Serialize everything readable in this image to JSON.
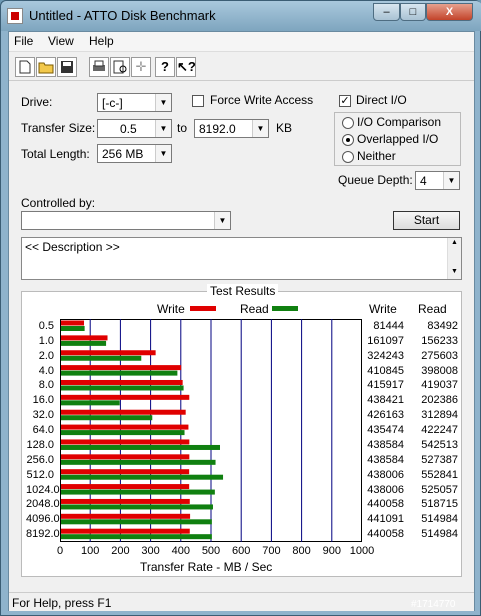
{
  "window": {
    "title": "Untitled - ATTO Disk Benchmark",
    "minimize": "–",
    "maximize": "□",
    "close": "X"
  },
  "menu": [
    "File",
    "View",
    "Help"
  ],
  "toolbar": [
    "⬜",
    "📂",
    "💾",
    "🖨",
    "🔍",
    "✛",
    "?",
    "↖"
  ],
  "form": {
    "drive_label": "Drive:",
    "drive_value": "[-c-]",
    "transfer_label": "Transfer Size:",
    "transfer_from": "0.5",
    "transfer_to_label": "to",
    "transfer_to": "8192.0",
    "transfer_unit": "KB",
    "length_label": "Total Length:",
    "length_value": "256 MB",
    "force_write": "Force Write Access",
    "direct_io": "Direct I/O",
    "io_comparison": "I/O Comparison",
    "overlapped_io": "Overlapped I/O",
    "neither": "Neither",
    "queue_label": "Queue Depth:",
    "queue_value": "4",
    "controlled_label": "Controlled by:",
    "controlled_value": "",
    "start_label": "Start",
    "description": "<< Description >>"
  },
  "results": {
    "title": "Test Results",
    "write_legend": "Write",
    "read_legend": "Read",
    "write_col": "Write",
    "read_col": "Read",
    "xlabel": "Transfer Rate - MB / Sec"
  },
  "colors": {
    "write": "#e00000",
    "read": "#108010",
    "grid": "#000080"
  },
  "chart_data": {
    "type": "bar",
    "orientation": "horizontal",
    "categories": [
      "0.5",
      "1.0",
      "2.0",
      "4.0",
      "8.0",
      "16.0",
      "32.0",
      "64.0",
      "128.0",
      "256.0",
      "512.0",
      "1024.0",
      "2048.0",
      "4096.0",
      "8192.0"
    ],
    "series": [
      {
        "name": "Write",
        "values": [
          81444,
          161097,
          324243,
          410845,
          415917,
          438421,
          426163,
          435474,
          438584,
          438584,
          438006,
          438006,
          440058,
          441091,
          440058
        ]
      },
      {
        "name": "Read",
        "values": [
          83492,
          156233,
          275603,
          398008,
          419037,
          202386,
          312894,
          422247,
          542513,
          527387,
          552841,
          525057,
          518715,
          514984,
          514984
        ]
      }
    ],
    "xlim": [
      0,
      1000
    ],
    "xticks": [
      "0",
      "100",
      "200",
      "300",
      "400",
      "500",
      "600",
      "700",
      "800",
      "900",
      "1000"
    ],
    "xlabel": "Transfer Rate - MB / Sec"
  },
  "status": "For Help, press F1",
  "watermark": "#1714770"
}
